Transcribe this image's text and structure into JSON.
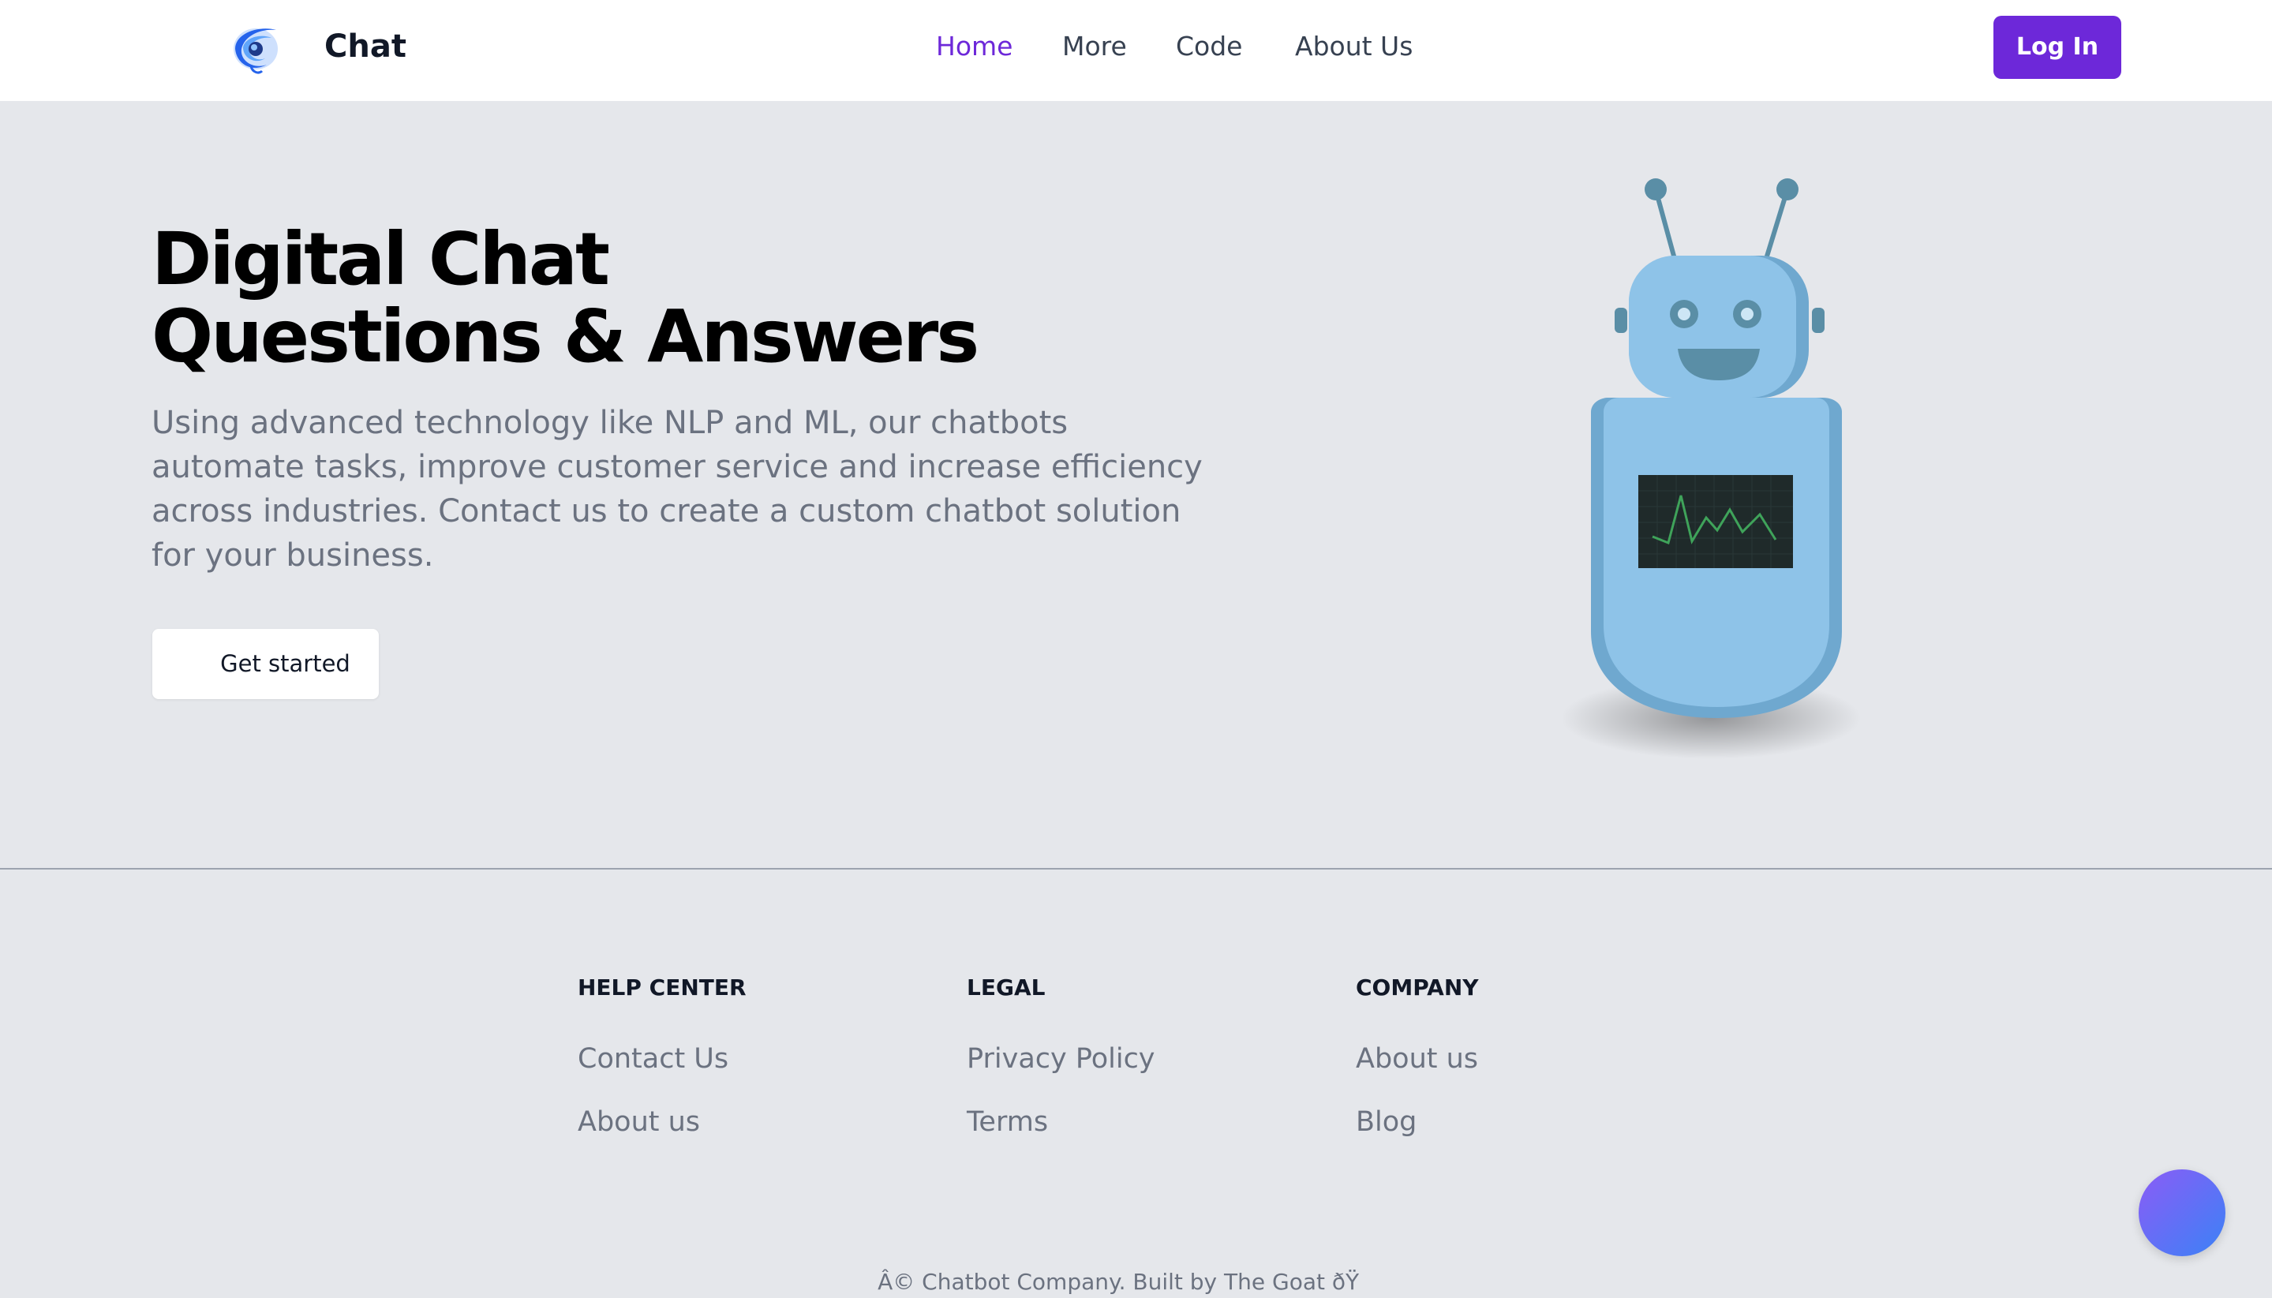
{
  "header": {
    "brand": "Chat",
    "nav": [
      {
        "label": "Home",
        "active": true
      },
      {
        "label": "More",
        "active": false
      },
      {
        "label": "Code",
        "active": false
      },
      {
        "label": "About Us",
        "active": false
      }
    ],
    "login_label": "Log In"
  },
  "hero": {
    "title_line1": "Digital Chat",
    "title_line2": "Questions & Answers",
    "description": "Using advanced technology like NLP and ML, our chatbots automate tasks, improve customer service and increase efficiency across industries. Contact us to create a custom chatbot solution for your business.",
    "cta_label": "Get started",
    "illustration": "robot-illustration"
  },
  "footer": {
    "columns": [
      {
        "heading": "HELP CENTER",
        "links": [
          "Contact Us",
          "About us"
        ]
      },
      {
        "heading": "LEGAL",
        "links": [
          "Privacy Policy",
          "Terms"
        ]
      },
      {
        "heading": "COMPANY",
        "links": [
          "About us",
          "Blog"
        ]
      }
    ],
    "copyright": "Â© Chatbot Company. Built by The Goat ðŸ"
  },
  "colors": {
    "accent": "#6d28d9",
    "page_bg": "#e5e7eb",
    "header_bg": "#ffffff",
    "muted_text": "#6b7280",
    "robot_blue": "#8ec3e8",
    "chat_bubble_gradient": [
      "#8b5cf6",
      "#3b82f6"
    ]
  },
  "icons": {
    "logo": "swirl-logo-icon",
    "chat_bubble": "chat-bubble-icon"
  }
}
